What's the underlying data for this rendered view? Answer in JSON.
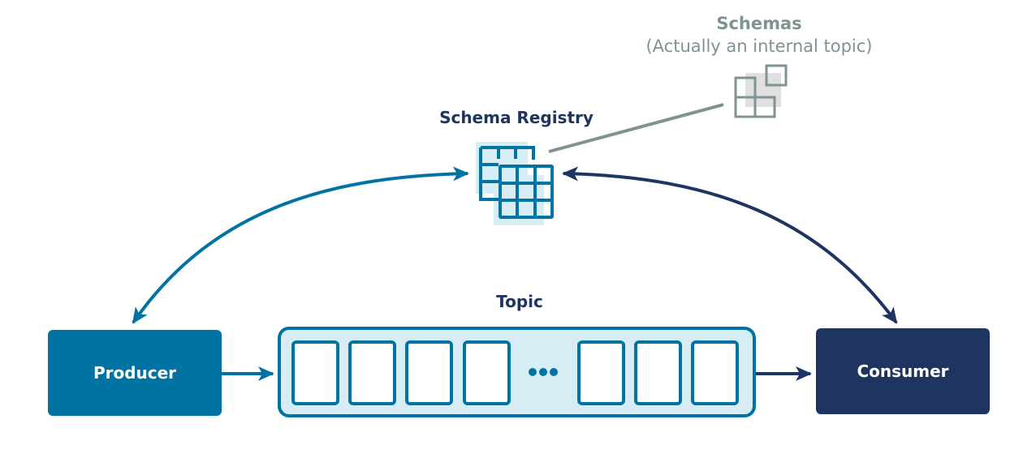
{
  "diagram": {
    "schemas": {
      "title": "Schemas",
      "subtitle": "(Actually an internal topic)",
      "icon": "schemas-icon"
    },
    "schema_registry": {
      "label": "Schema Registry",
      "icon": "schema-registry-table-icon"
    },
    "topic": {
      "label": "Topic",
      "partition_count_visible": 7,
      "ellipsis": "•••"
    },
    "producer": {
      "label": "Producer"
    },
    "consumer": {
      "label": "Consumer"
    },
    "connections": [
      {
        "from": "producer",
        "to": "schema_registry",
        "style": "bidirectional-curve"
      },
      {
        "from": "consumer",
        "to": "schema_registry",
        "style": "bidirectional-curve"
      },
      {
        "from": "producer",
        "to": "topic",
        "style": "arrow"
      },
      {
        "from": "topic",
        "to": "consumer",
        "style": "arrow"
      },
      {
        "from": "schema_registry",
        "to": "schemas",
        "style": "line"
      }
    ],
    "colors": {
      "producer": "#0073a2",
      "consumer": "#1e3461",
      "topic_fill": "#d6edf5",
      "topic_border": "#0073a2",
      "schemas_gray": "#7f9294",
      "label_navy": "#1e3461"
    }
  }
}
